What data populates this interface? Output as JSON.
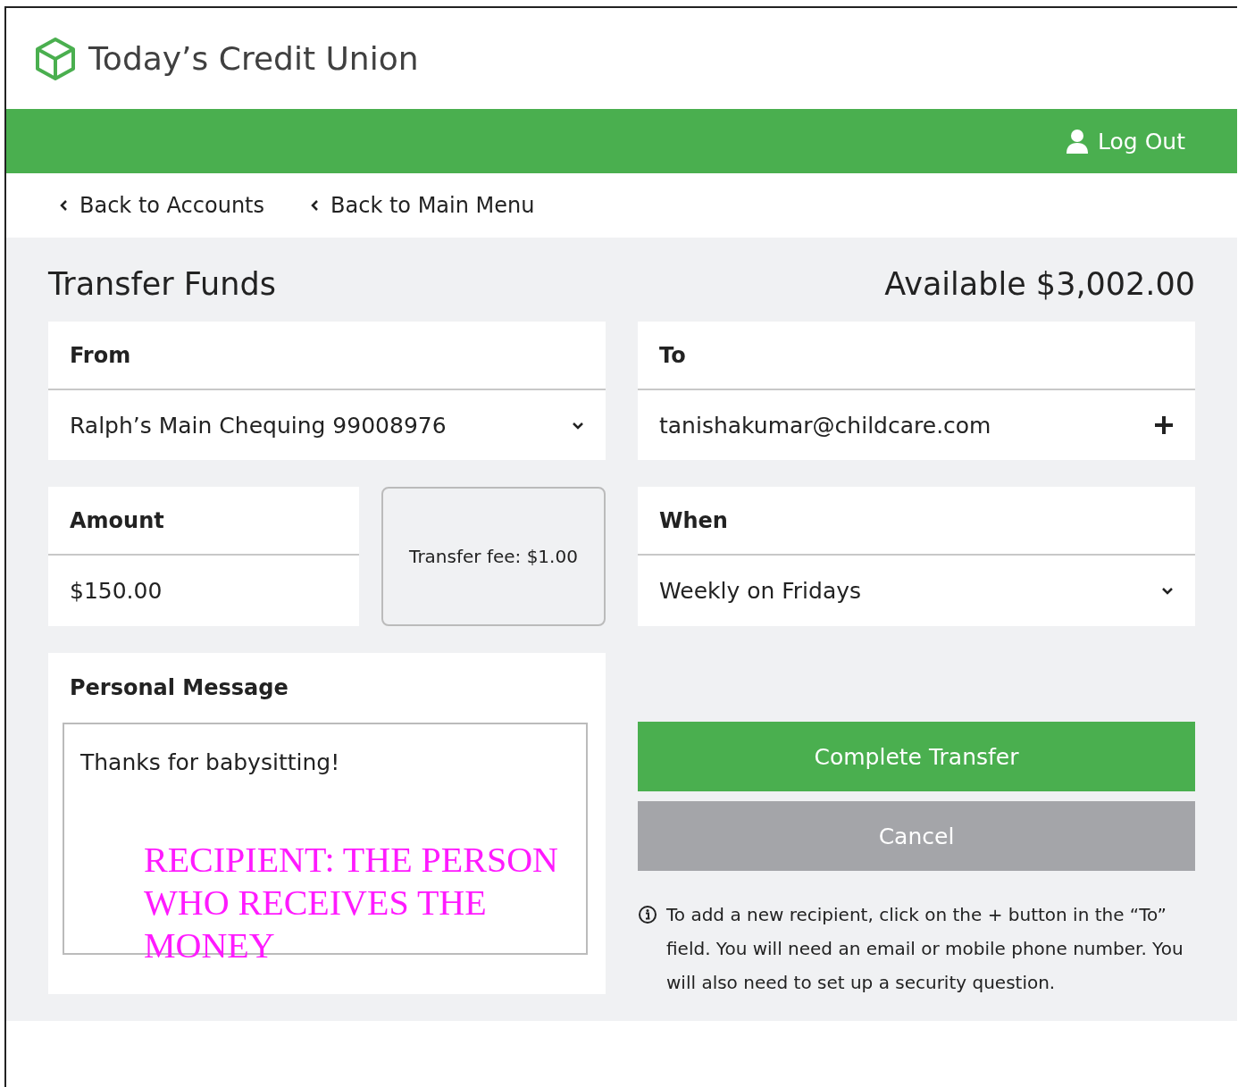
{
  "brand": {
    "name": "Today’s Credit Union"
  },
  "top_bar": {
    "logout": "Log Out"
  },
  "nav": [
    {
      "label": "Back to Accounts"
    },
    {
      "label": "Back to Main Menu"
    }
  ],
  "page": {
    "title": "Transfer Funds",
    "available": "Available $3,002.00"
  },
  "from": {
    "label": "From",
    "value": "Ralph’s Main Chequing 99008976"
  },
  "to": {
    "label": "To",
    "value": "tanishakumar@childcare.com"
  },
  "amount": {
    "label": "Amount",
    "value": "$150.00"
  },
  "fee": "Transfer fee: $1.00",
  "when": {
    "label": "When",
    "value": "Weekly on Fridays"
  },
  "message": {
    "label": "Personal Message",
    "value": "Thanks for babysitting!"
  },
  "annotation": "RECIPIENT: THE PERSON WHO RECEIVES THE MONEY",
  "buttons": [
    {
      "label": "Complete Transfer",
      "kind": "primary"
    },
    {
      "label": "Cancel",
      "kind": "secondary"
    }
  ],
  "note": "To add a new recipient, click on the + button in the “To” field. You will need an email or mobile phone number. You will also need to set up a security question."
}
